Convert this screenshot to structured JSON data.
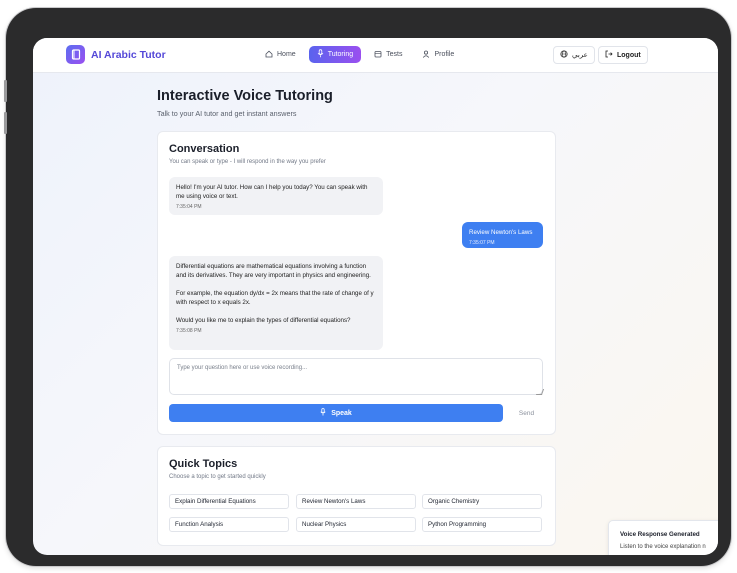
{
  "brand": {
    "name": "AI Arabic Tutor"
  },
  "nav": {
    "items": [
      {
        "label": "Home",
        "icon": "home-icon"
      },
      {
        "label": "Tutoring",
        "icon": "mic-icon",
        "active": true
      },
      {
        "label": "Tests",
        "icon": "calendar-icon"
      },
      {
        "label": "Profile",
        "icon": "user-icon"
      }
    ]
  },
  "header": {
    "language_label": "عربي",
    "logout_label": "Logout"
  },
  "page": {
    "title": "Interactive Voice Tutoring",
    "subtitle": "Talk to your AI tutor and get instant answers"
  },
  "conversation": {
    "title": "Conversation",
    "subtitle": "You can speak or type - I will respond in the way you prefer",
    "messages": [
      {
        "role": "assistant",
        "text": "Hello! I'm your AI tutor. How can I help you today? You can speak with me using voice or text.",
        "time": "7:35:04 PM"
      },
      {
        "role": "user",
        "text": "Review Newton's Laws",
        "time": "7:35:07 PM"
      },
      {
        "role": "assistant",
        "text": "Differential equations are mathematical equations involving a function and its derivatives. They are very important in physics and engineering.\n\nFor example, the equation dy/dx = 2x means that the rate of change of y with respect to x equals 2x.\n\nWould you like me to explain the types of differential equations?",
        "time": "7:35:08 PM"
      }
    ],
    "input_placeholder": "Type your question here or use voice recording...",
    "speak_label": "Speak",
    "send_label": "Send"
  },
  "quick_topics": {
    "title": "Quick Topics",
    "subtitle": "Choose a topic to get started quickly",
    "items": [
      "Explain Differential Equations",
      "Review Newton's Laws",
      "Organic Chemistry",
      "Function Analysis",
      "Nuclear Physics",
      "Python Programming"
    ]
  },
  "toast": {
    "title": "Voice Response Generated",
    "text": "Listen to the voice explanation n"
  },
  "colors": {
    "accent": "#3e7ff1",
    "brand_start": "#5a63ee",
    "brand_end": "#9a4fef"
  }
}
